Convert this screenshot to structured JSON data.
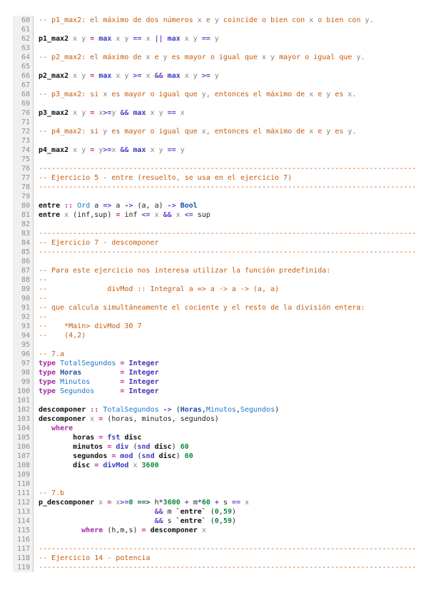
{
  "editor": {
    "language": "haskell",
    "first_line_number": 60,
    "last_line_number": 119,
    "colors": {
      "background": "#ffffff",
      "gutter_bg": "#f0f0f0",
      "gutter_border": "#c8c8c8",
      "line_number": "#8c8c96",
      "comment": "#c75b0b",
      "comment_variable": "#808080",
      "keyword": "#a62ba6",
      "equals": "#c7269c",
      "operator": "#6b3fc9",
      "builtin": "#3b3bc4",
      "type_name": "#2175c8",
      "type_bold_navy": "#1e4ea8",
      "type_integer": "#4733b5",
      "number": "#0d8a42",
      "implication": "#0a5c2e",
      "function_def": "#111111",
      "plain": "#222222"
    },
    "lines": [
      {
        "n": 60,
        "t": [
          [
            "c",
            "-- p1_max2: el máximo de dos números "
          ],
          [
            "v",
            "x"
          ],
          [
            "c",
            " e "
          ],
          [
            "v",
            "y"
          ],
          [
            "c",
            " coincide o bien con "
          ],
          [
            "v",
            "x"
          ],
          [
            "c",
            " o bien con "
          ],
          [
            "v",
            "y"
          ],
          [
            "c",
            "."
          ]
        ]
      },
      {
        "n": 61,
        "t": []
      },
      {
        "n": 62,
        "t": [
          [
            "f",
            "p1_max2"
          ],
          [
            "v",
            " x y "
          ],
          [
            "e",
            "="
          ],
          [
            "b",
            " max"
          ],
          [
            "v",
            " x y "
          ],
          [
            "o",
            "=="
          ],
          [
            "v",
            " x "
          ],
          [
            "o",
            "||"
          ],
          [
            "b",
            " max"
          ],
          [
            "v",
            " x y "
          ],
          [
            "o",
            "=="
          ],
          [
            "v",
            " y"
          ]
        ]
      },
      {
        "n": 63,
        "t": []
      },
      {
        "n": 64,
        "t": [
          [
            "c",
            "-- p2_max2: el máximo de "
          ],
          [
            "v",
            "x"
          ],
          [
            "c",
            " e "
          ],
          [
            "v",
            "y"
          ],
          [
            "c",
            " es mayor o igual que "
          ],
          [
            "v",
            "x"
          ],
          [
            "c",
            " "
          ],
          [
            "v",
            "y"
          ],
          [
            "c",
            " mayor o igual que "
          ],
          [
            "v",
            "y"
          ],
          [
            "c",
            "."
          ]
        ]
      },
      {
        "n": 65,
        "t": []
      },
      {
        "n": 66,
        "t": [
          [
            "f",
            "p2_max2"
          ],
          [
            "v",
            " x y "
          ],
          [
            "e",
            "="
          ],
          [
            "b",
            " max"
          ],
          [
            "v",
            " x y "
          ],
          [
            "o",
            ">="
          ],
          [
            "v",
            " x "
          ],
          [
            "o",
            "&&"
          ],
          [
            "b",
            " max"
          ],
          [
            "v",
            " x y "
          ],
          [
            "o",
            ">="
          ],
          [
            "v",
            " y"
          ]
        ]
      },
      {
        "n": 67,
        "t": []
      },
      {
        "n": 68,
        "t": [
          [
            "c",
            "-- p3_max2: si "
          ],
          [
            "v",
            "x"
          ],
          [
            "c",
            " es mayor o igual que "
          ],
          [
            "v",
            "y"
          ],
          [
            "c",
            ", entonces el máximo de "
          ],
          [
            "v",
            "x"
          ],
          [
            "c",
            " e "
          ],
          [
            "v",
            "y"
          ],
          [
            "c",
            " es "
          ],
          [
            "v",
            "x"
          ],
          [
            "c",
            "."
          ]
        ]
      },
      {
        "n": 69,
        "t": []
      },
      {
        "n": 70,
        "t": [
          [
            "f",
            "p3_max2"
          ],
          [
            "v",
            " x y "
          ],
          [
            "e",
            "="
          ],
          [
            "v",
            " x"
          ],
          [
            "o",
            ">="
          ],
          [
            "v",
            "y "
          ],
          [
            "o",
            "&&"
          ],
          [
            "b",
            " max"
          ],
          [
            "v",
            " x y "
          ],
          [
            "o",
            "=="
          ],
          [
            "v",
            " x"
          ]
        ]
      },
      {
        "n": 71,
        "t": []
      },
      {
        "n": 72,
        "t": [
          [
            "c",
            "-- p4_max2: si "
          ],
          [
            "v",
            "y"
          ],
          [
            "c",
            " es mayor o igual que "
          ],
          [
            "v",
            "x"
          ],
          [
            "c",
            ", entonces el máximo de "
          ],
          [
            "v",
            "x"
          ],
          [
            "c",
            " e "
          ],
          [
            "v",
            "y"
          ],
          [
            "c",
            " es "
          ],
          [
            "v",
            "y"
          ],
          [
            "c",
            "."
          ]
        ]
      },
      {
        "n": 73,
        "t": []
      },
      {
        "n": 74,
        "t": [
          [
            "f",
            "p4_max2"
          ],
          [
            "v",
            " x y "
          ],
          [
            "e",
            "="
          ],
          [
            "v",
            " y"
          ],
          [
            "o",
            ">="
          ],
          [
            "v",
            "x "
          ],
          [
            "o",
            "&&"
          ],
          [
            "b",
            " max"
          ],
          [
            "v",
            " x y "
          ],
          [
            "o",
            "=="
          ],
          [
            "v",
            " y"
          ]
        ]
      },
      {
        "n": 75,
        "t": []
      },
      {
        "n": 76,
        "t": [
          [
            "c",
            "----------------------------------------------------------------------------------------"
          ]
        ]
      },
      {
        "n": 77,
        "t": [
          [
            "c",
            "-- Ejercicio 5 - entre (resuelto, se usa en el ejercicio 7)"
          ]
        ]
      },
      {
        "n": 78,
        "t": [
          [
            "c",
            "----------------------------------------------------------------------------------------"
          ]
        ]
      },
      {
        "n": 79,
        "t": []
      },
      {
        "n": 80,
        "t": [
          [
            "f",
            "entre"
          ],
          [
            "p",
            " "
          ],
          [
            "e",
            "::"
          ],
          [
            "t",
            " Ord"
          ],
          [
            "p",
            " a "
          ],
          [
            "o",
            "=>"
          ],
          [
            "p",
            " a "
          ],
          [
            "o",
            "->"
          ],
          [
            "p",
            " (a, a) "
          ],
          [
            "o",
            "->"
          ],
          [
            "T",
            " Bool"
          ]
        ]
      },
      {
        "n": 81,
        "t": [
          [
            "f",
            "entre"
          ],
          [
            "v",
            " x "
          ],
          [
            "p",
            "(inf,sup) "
          ],
          [
            "e",
            "="
          ],
          [
            "p",
            " inf "
          ],
          [
            "o",
            "<="
          ],
          [
            "v",
            " x "
          ],
          [
            "o",
            "&&"
          ],
          [
            "v",
            " x "
          ],
          [
            "o",
            "<="
          ],
          [
            "p",
            " sup"
          ]
        ]
      },
      {
        "n": 82,
        "t": []
      },
      {
        "n": 83,
        "t": [
          [
            "c",
            "----------------------------------------------------------------------------------------"
          ]
        ]
      },
      {
        "n": 84,
        "t": [
          [
            "c",
            "-- Ejercicio 7 - descomponer"
          ]
        ]
      },
      {
        "n": 85,
        "t": [
          [
            "c",
            "----------------------------------------------------------------------------------------"
          ]
        ]
      },
      {
        "n": 86,
        "t": []
      },
      {
        "n": 87,
        "t": [
          [
            "c",
            "-- Para este ejercicio nos interesa utilizar la función predefinida:"
          ]
        ]
      },
      {
        "n": 88,
        "t": [
          [
            "c",
            "--"
          ]
        ]
      },
      {
        "n": 89,
        "t": [
          [
            "c",
            "--              divMod :: Integral a => a -> a -> (a, a)"
          ]
        ]
      },
      {
        "n": 90,
        "t": [
          [
            "c",
            "--"
          ]
        ]
      },
      {
        "n": 91,
        "t": [
          [
            "c",
            "-- que calcula simultáneamente el cociente y el resto de la división entera:"
          ]
        ]
      },
      {
        "n": 92,
        "t": [
          [
            "c",
            "--"
          ]
        ]
      },
      {
        "n": 93,
        "t": [
          [
            "c",
            "--    *Main> divMod 30 7"
          ]
        ]
      },
      {
        "n": 94,
        "t": [
          [
            "c",
            "--    (4,2)"
          ]
        ]
      },
      {
        "n": 95,
        "t": []
      },
      {
        "n": 96,
        "t": [
          [
            "c",
            "-- 7.a"
          ]
        ]
      },
      {
        "n": 97,
        "t": [
          [
            "k",
            "type"
          ],
          [
            "t",
            " TotalSegundos "
          ],
          [
            "e",
            "="
          ],
          [
            "I",
            " Integer"
          ]
        ]
      },
      {
        "n": 98,
        "t": [
          [
            "k",
            "type"
          ],
          [
            "T",
            " Horas"
          ],
          [
            "p",
            "         "
          ],
          [
            "e",
            "="
          ],
          [
            "I",
            " Integer"
          ]
        ]
      },
      {
        "n": 99,
        "t": [
          [
            "k",
            "type"
          ],
          [
            "t",
            " Minutos"
          ],
          [
            "p",
            "       "
          ],
          [
            "e",
            "="
          ],
          [
            "I",
            " Integer"
          ]
        ]
      },
      {
        "n": 100,
        "t": [
          [
            "k",
            "type"
          ],
          [
            "t",
            " Segundos"
          ],
          [
            "p",
            "      "
          ],
          [
            "e",
            "="
          ],
          [
            "I",
            " Integer"
          ]
        ]
      },
      {
        "n": 101,
        "t": []
      },
      {
        "n": 102,
        "t": [
          [
            "f",
            "descomponer"
          ],
          [
            "p",
            " "
          ],
          [
            "e",
            "::"
          ],
          [
            "t",
            " TotalSegundos "
          ],
          [
            "o",
            "->"
          ],
          [
            "p",
            " ("
          ],
          [
            "T",
            "Horas"
          ],
          [
            "p",
            ","
          ],
          [
            "t",
            "Minutos"
          ],
          [
            "p",
            ","
          ],
          [
            "t",
            "Segundos"
          ],
          [
            "p",
            ")"
          ]
        ]
      },
      {
        "n": 103,
        "t": [
          [
            "f",
            "descomponer"
          ],
          [
            "v",
            " x "
          ],
          [
            "e",
            "="
          ],
          [
            "p",
            " (horas, minutos, segundos)"
          ]
        ]
      },
      {
        "n": 104,
        "t": [
          [
            "p",
            "   "
          ],
          [
            "k",
            "where"
          ]
        ]
      },
      {
        "n": 105,
        "t": [
          [
            "p",
            "        "
          ],
          [
            "f",
            "horas "
          ],
          [
            "e",
            "="
          ],
          [
            "b",
            " fst "
          ],
          [
            "f",
            "disc"
          ]
        ]
      },
      {
        "n": 106,
        "t": [
          [
            "p",
            "        "
          ],
          [
            "f",
            "minutos "
          ],
          [
            "e",
            "="
          ],
          [
            "b",
            " div "
          ],
          [
            "p",
            "("
          ],
          [
            "b",
            "snd "
          ],
          [
            "f",
            "disc"
          ],
          [
            "p",
            ") "
          ],
          [
            "n",
            "60"
          ]
        ]
      },
      {
        "n": 107,
        "t": [
          [
            "p",
            "        "
          ],
          [
            "f",
            "segundos "
          ],
          [
            "e",
            "="
          ],
          [
            "b",
            " mod "
          ],
          [
            "p",
            "("
          ],
          [
            "b",
            "snd "
          ],
          [
            "f",
            "disc"
          ],
          [
            "p",
            ") "
          ],
          [
            "n",
            "60"
          ]
        ]
      },
      {
        "n": 108,
        "t": [
          [
            "p",
            "        "
          ],
          [
            "f",
            "disc "
          ],
          [
            "e",
            "="
          ],
          [
            "b",
            " divMod"
          ],
          [
            "v",
            " x "
          ],
          [
            "n",
            "3600"
          ]
        ]
      },
      {
        "n": 109,
        "t": []
      },
      {
        "n": 110,
        "t": []
      },
      {
        "n": 111,
        "t": [
          [
            "c",
            "-- 7.b"
          ]
        ]
      },
      {
        "n": 112,
        "t": [
          [
            "f",
            "p_descomponer"
          ],
          [
            "v",
            " x "
          ],
          [
            "e",
            "="
          ],
          [
            "v",
            " x"
          ],
          [
            "o",
            ">="
          ],
          [
            "n",
            "0"
          ],
          [
            "i",
            " ==> "
          ],
          [
            "p",
            "h"
          ],
          [
            "o",
            "*"
          ],
          [
            "n",
            "3600"
          ],
          [
            "o",
            " + "
          ],
          [
            "p",
            "m"
          ],
          [
            "o",
            "*"
          ],
          [
            "n",
            "60"
          ],
          [
            "o",
            " + "
          ],
          [
            "p",
            "s "
          ],
          [
            "o",
            "=="
          ],
          [
            "v",
            " x"
          ]
        ]
      },
      {
        "n": 113,
        "t": [
          [
            "p",
            "                           "
          ],
          [
            "o",
            "&&"
          ],
          [
            "p",
            " m "
          ],
          [
            "f",
            "`entre`"
          ],
          [
            "p",
            " ("
          ],
          [
            "n",
            "0"
          ],
          [
            "p",
            ","
          ],
          [
            "n",
            "59"
          ],
          [
            "p",
            ")"
          ]
        ]
      },
      {
        "n": 114,
        "t": [
          [
            "p",
            "                           "
          ],
          [
            "o",
            "&&"
          ],
          [
            "p",
            " s "
          ],
          [
            "f",
            "`entre`"
          ],
          [
            "p",
            " ("
          ],
          [
            "n",
            "0"
          ],
          [
            "p",
            ","
          ],
          [
            "n",
            "59"
          ],
          [
            "p",
            ")"
          ]
        ]
      },
      {
        "n": 115,
        "t": [
          [
            "p",
            "          "
          ],
          [
            "k",
            "where"
          ],
          [
            "p",
            " (h,m,s) "
          ],
          [
            "e",
            "="
          ],
          [
            "f",
            " descomponer"
          ],
          [
            "v",
            " x"
          ]
        ]
      },
      {
        "n": 116,
        "t": []
      },
      {
        "n": 117,
        "t": [
          [
            "c",
            "----------------------------------------------------------------------------------------"
          ]
        ]
      },
      {
        "n": 118,
        "t": [
          [
            "c",
            "-- Ejercicio 14 - potencia"
          ]
        ]
      },
      {
        "n": 119,
        "t": [
          [
            "c",
            "----------------------------------------------------------------------------------------"
          ]
        ]
      }
    ]
  }
}
